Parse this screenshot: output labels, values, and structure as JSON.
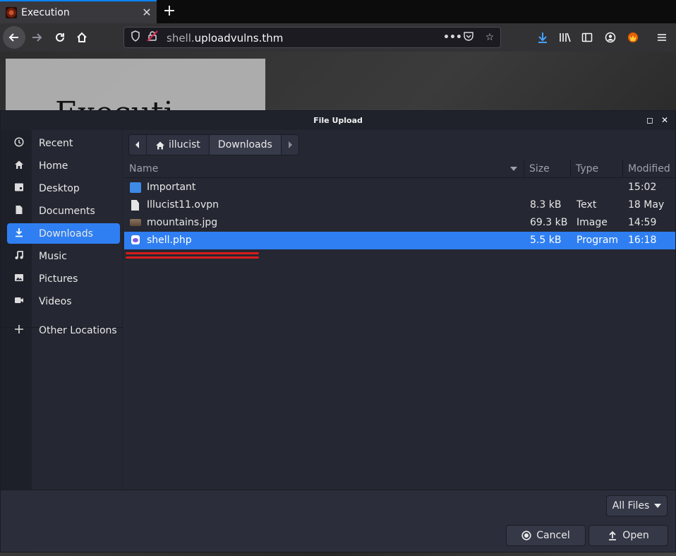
{
  "browser": {
    "tab_title": "Execution",
    "tab_close": "✕",
    "new_tab": "+",
    "url_prefix": "shell.",
    "url_domain": "uploadvulns.thm"
  },
  "page_bg_text": "Executi",
  "dialog": {
    "title": "File Upload",
    "sidebar": [
      {
        "label": "Recent",
        "icon": "clock-icon"
      },
      {
        "label": "Home",
        "icon": "home-icon"
      },
      {
        "label": "Desktop",
        "icon": "desktop-icon"
      },
      {
        "label": "Documents",
        "icon": "document-icon"
      },
      {
        "label": "Downloads",
        "icon": "download-icon",
        "active": true
      },
      {
        "label": "Music",
        "icon": "music-icon"
      },
      {
        "label": "Pictures",
        "icon": "picture-icon"
      },
      {
        "label": "Videos",
        "icon": "video-icon"
      },
      {
        "label": "Other Locations",
        "icon": "plus-icon"
      }
    ],
    "path": [
      "illucist",
      "Downloads"
    ],
    "columns": {
      "name": "Name",
      "size": "Size",
      "type": "Type",
      "modified": "Modified"
    },
    "files": [
      {
        "name": "Important",
        "size": "",
        "type": "",
        "modified": "15:02",
        "kind": "folder"
      },
      {
        "name": "Illucist11.ovpn",
        "size": "8.3 kB",
        "type": "Text",
        "modified": "18 May",
        "kind": "text"
      },
      {
        "name": "mountains.jpg",
        "size": "69.3 kB",
        "type": "Image",
        "modified": "14:59",
        "kind": "image"
      },
      {
        "name": "shell.php",
        "size": "5.5 kB",
        "type": "Program",
        "modified": "16:18",
        "kind": "program",
        "selected": true
      }
    ],
    "filter": "All Files",
    "cancel": "Cancel",
    "open": "Open"
  },
  "colors": {
    "accent": "#2f7ff2",
    "annotation": "#d81d1d"
  }
}
